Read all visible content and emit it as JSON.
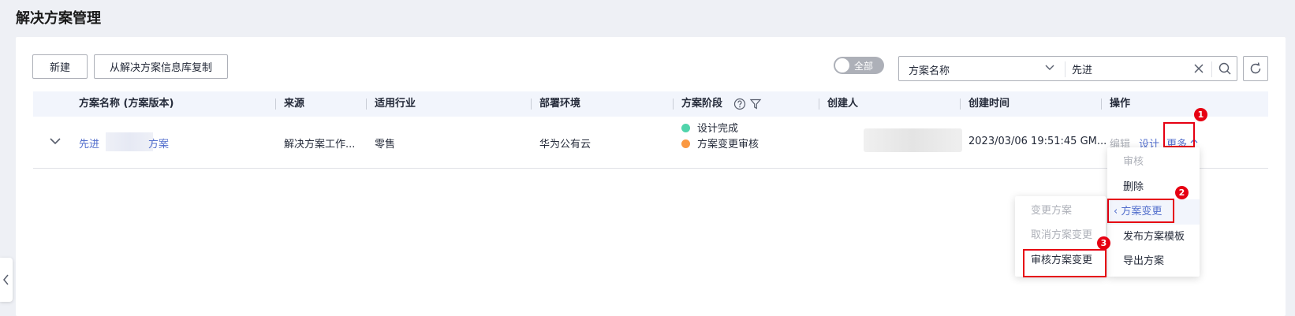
{
  "page": {
    "title": "解决方案管理"
  },
  "toolbar": {
    "new_label": "新建",
    "copy_label": "从解决方案信息库复制",
    "toggle_label": "全部",
    "search_field": "方案名称",
    "search_value": "先进"
  },
  "table": {
    "headers": {
      "name": "方案名称 (方案版本)",
      "source": "来源",
      "industry": "适用行业",
      "env": "部署环境",
      "stage": "方案阶段",
      "creator": "创建人",
      "created_at": "创建时间",
      "actions": "操作"
    },
    "row": {
      "name_prefix": "先进",
      "name_suffix": "方案",
      "source": "解决方案工作...",
      "industry": "零售",
      "env": "华为公有云",
      "stage_1": "设计完成",
      "stage_1_color": "#50d4ab",
      "stage_2": "方案变更审核",
      "stage_2_color": "#fa9841",
      "created_at": "2023/03/06 19:51:45 GM...",
      "action_edit": "编辑",
      "action_design": "设计",
      "action_more": "更多"
    }
  },
  "more_menu": {
    "items": [
      "审核",
      "删除",
      "方案变更",
      "发布方案模板",
      "导出方案"
    ]
  },
  "sub_menu": {
    "items": [
      "变更方案",
      "取消方案变更",
      "审核方案变更"
    ]
  },
  "annotations": {
    "badge_1": "1",
    "badge_2": "2",
    "badge_3": "3"
  },
  "colors": {
    "accent": "#526ecc",
    "highlight": "#e60012"
  }
}
